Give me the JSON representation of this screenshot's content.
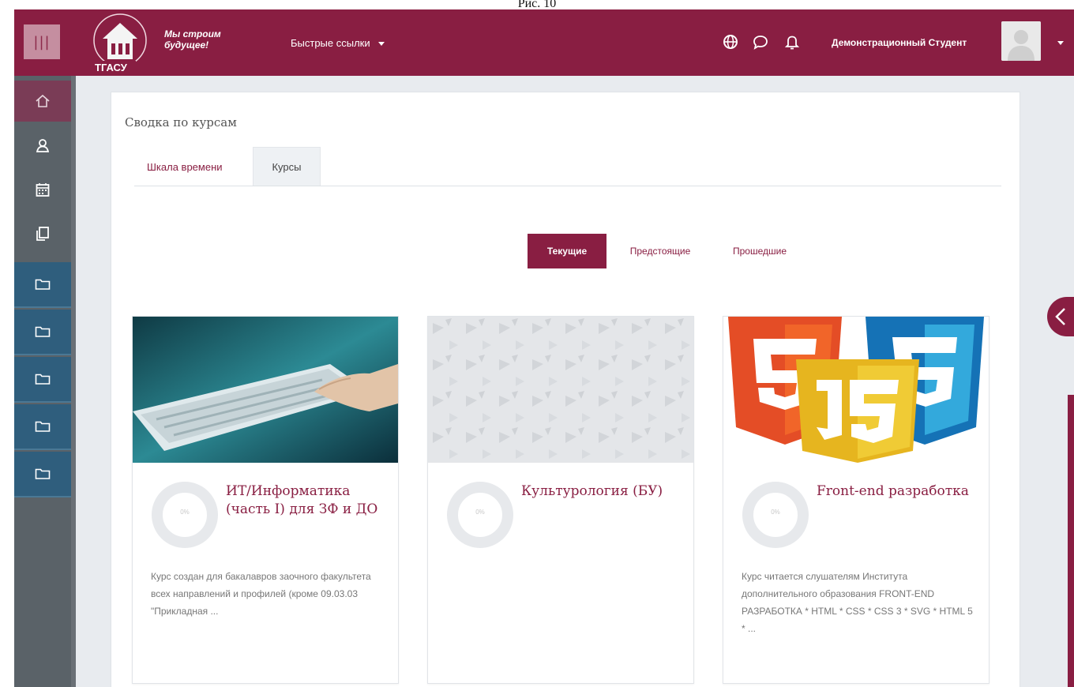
{
  "caption": "Рис. 10",
  "header": {
    "slogan_line1": "Мы строим",
    "slogan_line2": "будущее!",
    "logo_text": "ТГАСУ",
    "quick_links": "Быстрые ссылки",
    "username": "Демонстрационный Студент",
    "icons": [
      "menu-icon",
      "globe-icon",
      "chat-icon",
      "bell-icon",
      "chevron-down-icon"
    ]
  },
  "sidebar": {
    "items": [
      "home-icon",
      "user-icon",
      "calendar-icon",
      "files-icon",
      "folder-icon",
      "folder-icon",
      "folder-icon",
      "folder-icon",
      "folder-icon"
    ]
  },
  "main": {
    "section_title": "Сводка по курсам",
    "tabs": [
      {
        "label": "Шкала времени"
      },
      {
        "label": "Курсы"
      }
    ],
    "filters": [
      {
        "label": "Текущие",
        "active": true
      },
      {
        "label": "Предстоящие",
        "active": false
      },
      {
        "label": "Прошедшие",
        "active": false
      }
    ],
    "courses": [
      {
        "title": "ИТ/Информатика (часть I) для ЗФ и ДО",
        "progress": "0%",
        "description": "Курс создан для бакалавров заочного факультета всех направлений и профилей (кроме 09.03.03 \"Прикладная ..."
      },
      {
        "title": "Культурология (БУ)",
        "progress": "0%",
        "description": ""
      },
      {
        "title": "Front-end разработка",
        "progress": "0%",
        "description": "Курс читается слушателям Института дополнительного образования FRONT-END РАЗРАБОТКА * HTML * CSS * CSS 3 * SVG * HTML 5 * ..."
      }
    ]
  },
  "colors": {
    "brand": "#891e42",
    "sidebar": "#5a6268",
    "folder_item": "#2f5e7d",
    "content_bg": "#e8ebef"
  }
}
